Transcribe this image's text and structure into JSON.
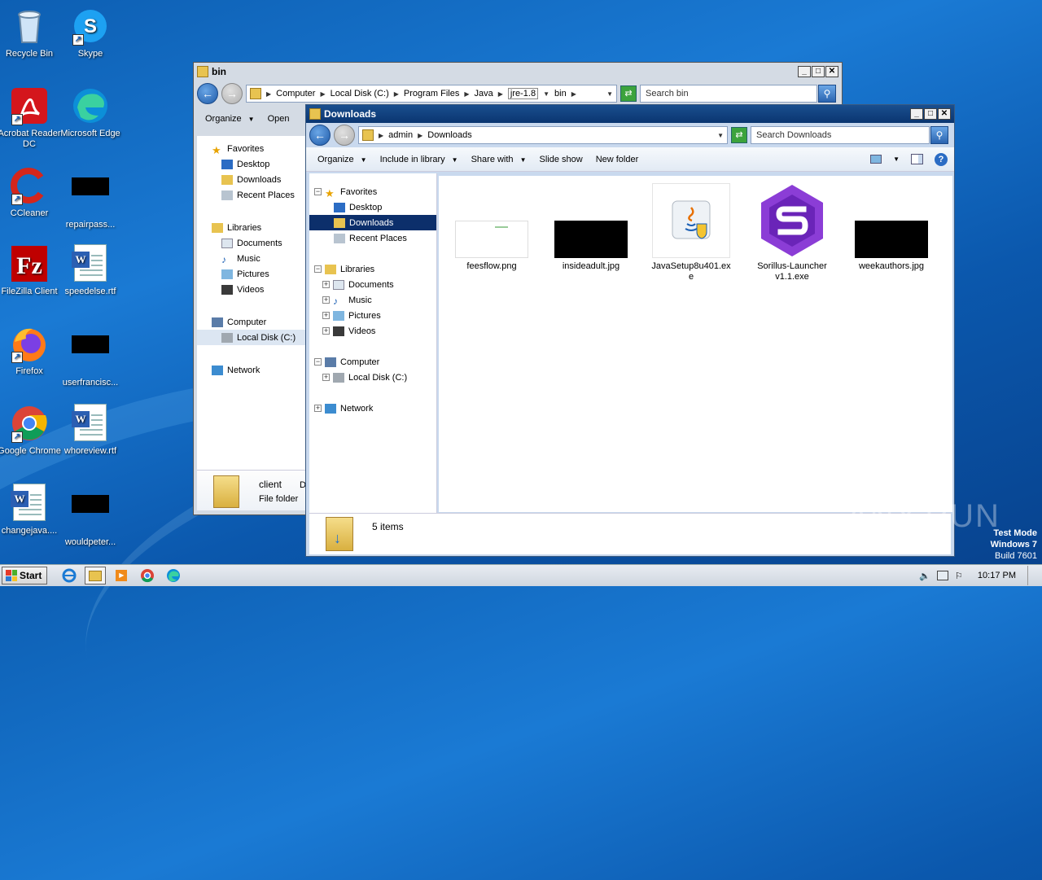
{
  "desktop": {
    "icons": [
      {
        "label": "Recycle Bin"
      },
      {
        "label": "Skype"
      },
      {
        "label": "Acrobat Reader DC"
      },
      {
        "label": "Microsoft Edge"
      },
      {
        "label": "CCleaner"
      },
      {
        "label": "repairpass..."
      },
      {
        "label": "FileZilla Client"
      },
      {
        "label": "speedelse.rtf"
      },
      {
        "label": "Firefox"
      },
      {
        "label": "userfrancisc..."
      },
      {
        "label": "Google Chrome"
      },
      {
        "label": "whoreview.rtf"
      },
      {
        "label": "changejava...."
      },
      {
        "label": "wouldpeter..."
      }
    ]
  },
  "bin_window": {
    "title": "bin",
    "breadcrumb": [
      "Computer",
      "Local Disk (C:)",
      "Program Files",
      "Java",
      "jre-1.8",
      "bin"
    ],
    "search_placeholder": "Search bin",
    "toolbar": {
      "organize": "Organize",
      "open": "Open"
    },
    "nav": {
      "favorites": "Favorites",
      "desktop": "Desktop",
      "downloads": "Downloads",
      "recent": "Recent Places",
      "libraries": "Libraries",
      "documents": "Documents",
      "music": "Music",
      "pictures": "Pictures",
      "videos": "Videos",
      "computer": "Computer",
      "localdisk": "Local Disk (C:)",
      "network": "Network"
    },
    "details": {
      "name": "client",
      "type": "File folder",
      "extra": "D"
    }
  },
  "downloads_window": {
    "title": "Downloads",
    "breadcrumb": [
      "admin",
      "Downloads"
    ],
    "search_placeholder": "Search Downloads",
    "toolbar": {
      "organize": "Organize",
      "include": "Include in library",
      "share": "Share with",
      "slideshow": "Slide show",
      "newfolder": "New folder"
    },
    "nav": {
      "favorites": "Favorites",
      "desktop": "Desktop",
      "downloads": "Downloads",
      "recent": "Recent Places",
      "libraries": "Libraries",
      "documents": "Documents",
      "music": "Music",
      "pictures": "Pictures",
      "videos": "Videos",
      "computer": "Computer",
      "localdisk": "Local Disk (C:)",
      "network": "Network"
    },
    "files": [
      {
        "name": "feesflow.png"
      },
      {
        "name": "insideadult.jpg"
      },
      {
        "name": "JavaSetup8u401.exe"
      },
      {
        "name": "Sorillus-Launcher v1.1.exe"
      },
      {
        "name": "weekauthors.jpg"
      }
    ],
    "status": "5 items"
  },
  "taskbar": {
    "start": "Start",
    "clock": "10:17 PM"
  },
  "watermark": {
    "line1": "Test Mode",
    "line2": "Windows 7",
    "line3": "Build 7601",
    "brand": "ANY.RUN"
  },
  "colors": {
    "selection": "#0c2f6b",
    "titlebar_active": "#c9d9ee",
    "desktop": "#1a7ad4"
  }
}
